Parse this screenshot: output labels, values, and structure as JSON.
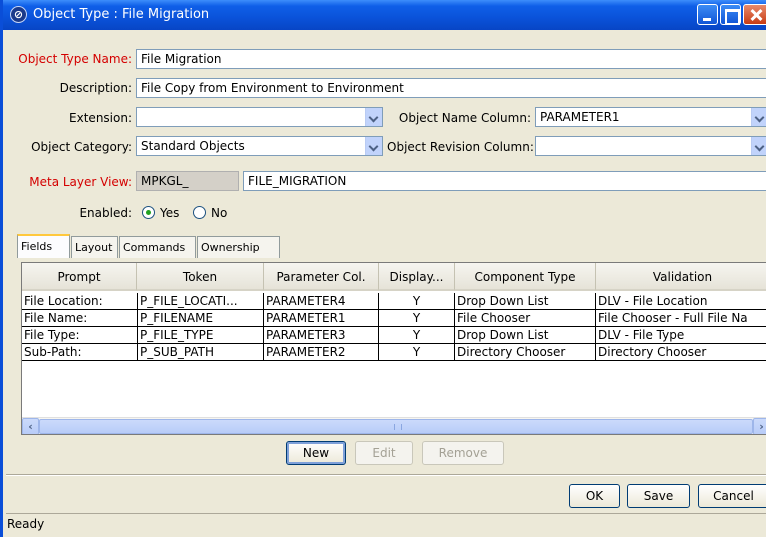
{
  "window": {
    "title": "Object Type : File Migration",
    "accent_color": "#0a52d9",
    "title_icon": "app-logo-icon"
  },
  "form": {
    "object_type_name": {
      "label": "Object Type Name:",
      "value": "File Migration"
    },
    "description": {
      "label": "Description:",
      "value": "File Copy from Environment to Environment"
    },
    "extension": {
      "label": "Extension:",
      "value": ""
    },
    "object_name_column": {
      "label": "Object Name Column:",
      "value": "PARAMETER1"
    },
    "object_category": {
      "label": "Object Category:",
      "value": "Standard Objects"
    },
    "object_revision_column": {
      "label": "Object Revision Column:",
      "value": ""
    },
    "meta_layer_view": {
      "label": "Meta Layer View:",
      "prefix": "MPKGL_",
      "value": "FILE_MIGRATION"
    },
    "enabled": {
      "label": "Enabled:",
      "yes": "Yes",
      "no": "No",
      "selected": "Yes"
    },
    "required_label_color": "#d40000"
  },
  "tabs": [
    {
      "label": "Fields",
      "active": true
    },
    {
      "label": "Layout",
      "active": false
    },
    {
      "label": "Commands",
      "active": false
    },
    {
      "label": "Ownership",
      "active": false
    }
  ],
  "table": {
    "columns": [
      "Prompt",
      "Token",
      "Parameter Col.",
      "Display...",
      "Component Type",
      "Validation"
    ],
    "rows": [
      [
        "File Location:",
        "P_FILE_LOCATI...",
        "PARAMETER4",
        "Y",
        "Drop Down List",
        "DLV - File Location"
      ],
      [
        "File Name:",
        "P_FILENAME",
        "PARAMETER1",
        "Y",
        "File Chooser",
        "File Chooser - Full File Na"
      ],
      [
        "File Type:",
        "P_FILE_TYPE",
        "PARAMETER3",
        "Y",
        "Drop Down List",
        "DLV - File Type"
      ],
      [
        "Sub-Path:",
        "P_SUB_PATH",
        "PARAMETER2",
        "Y",
        "Directory Chooser",
        "Directory Chooser"
      ]
    ]
  },
  "table_buttons": {
    "new": "New",
    "edit": "Edit",
    "remove": "Remove"
  },
  "dialog_buttons": {
    "ok": "OK",
    "save": "Save",
    "cancel": "Cancel"
  },
  "status": "Ready"
}
